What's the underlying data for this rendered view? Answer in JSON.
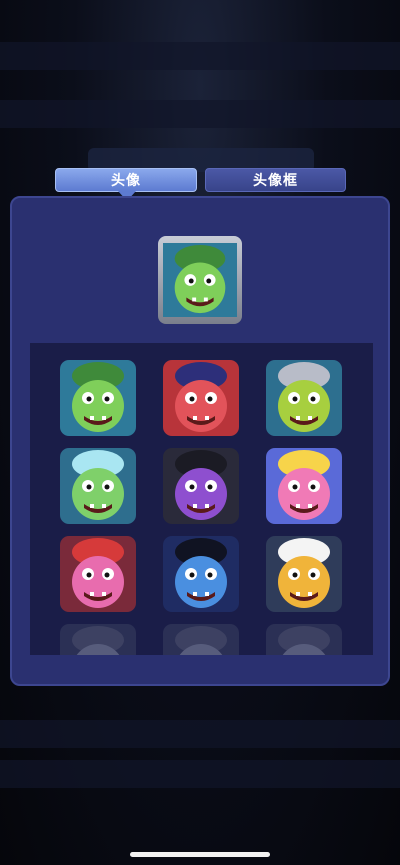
{
  "tabs": [
    {
      "label": "头像",
      "active": true
    },
    {
      "label": "头像框",
      "active": false
    }
  ],
  "selected_avatar": {
    "icon": "green-zombie-helmet-avatar"
  },
  "avatars": [
    {
      "icon": "green-zombie-helmet-avatar",
      "bg": "#2e7a9a",
      "skin": "#7fcf5a",
      "accent": "#3f8a3a"
    },
    {
      "icon": "red-masked-monster-avatar",
      "bg": "#b8343a",
      "skin": "#e2535a",
      "accent": "#2d2f7a"
    },
    {
      "icon": "knight-helmet-monster-avatar",
      "bg": "#2d6f8f",
      "skin": "#a7cf3f",
      "accent": "#b8bcc8"
    },
    {
      "icon": "astronaut-zombie-avatar",
      "bg": "#2e6e8e",
      "skin": "#7fd06a",
      "accent": "#a9e6f2"
    },
    {
      "icon": "purple-mobster-cigar-avatar",
      "bg": "#2a2a3a",
      "skin": "#8e4fcf",
      "accent": "#1b1b24"
    },
    {
      "icon": "pink-fairy-monster-avatar",
      "bg": "#5a6ad8",
      "skin": "#f07ab6",
      "accent": "#f7d44a"
    },
    {
      "icon": "red-football-helmet-avatar",
      "bg": "#7a2a3a",
      "skin": "#e86cae",
      "accent": "#d63a3a"
    },
    {
      "icon": "blue-elvis-sunglasses-avatar",
      "bg": "#1f2c63",
      "skin": "#4a8fe0",
      "accent": "#101322"
    },
    {
      "icon": "chef-mustache-monster-avatar",
      "bg": "#2f3c5a",
      "skin": "#f0b43a",
      "accent": "#f4f4f4"
    },
    {
      "icon": "gray-helmet-avatar-partial",
      "bg": "#3a4060",
      "skin": "#8a90a8",
      "accent": "#5a6078"
    },
    {
      "icon": "gray-knight-avatar-partial",
      "bg": "#3a4060",
      "skin": "#8a90a8",
      "accent": "#5a6078"
    },
    {
      "icon": "gray-bubble-avatar-partial",
      "bg": "#3a4060",
      "skin": "#8a90a8",
      "accent": "#5a6078"
    }
  ]
}
